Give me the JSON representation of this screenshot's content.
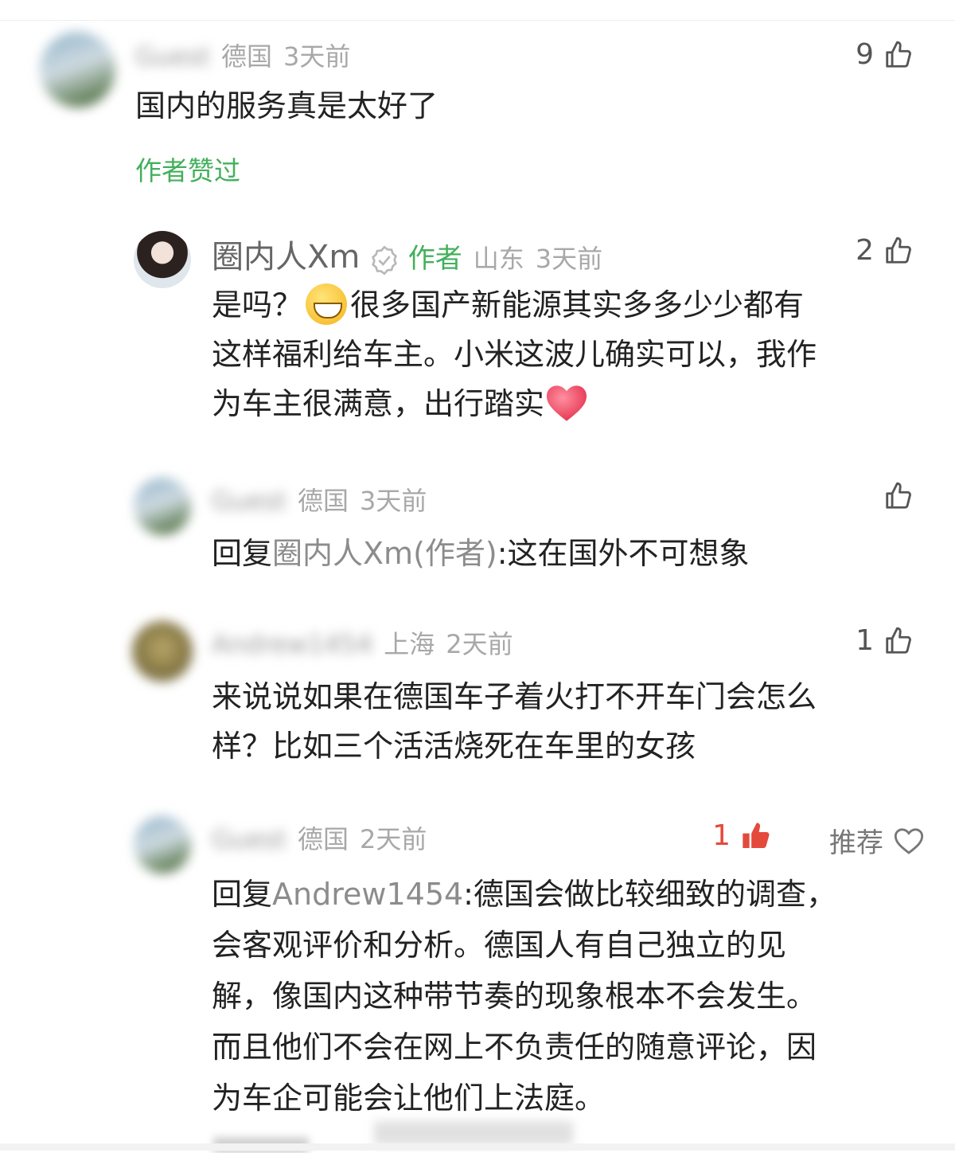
{
  "comments": [
    {
      "username": "Guest",
      "location": "德国",
      "time": "3天前",
      "likes": "9",
      "text": "国内的服务真是太好了",
      "liked_by_author": "作者赞过"
    },
    {
      "username": "圈内人Xm",
      "author_badge": "作者",
      "location": "山东",
      "time": "3天前",
      "likes": "2",
      "text_part1": "是吗？",
      "text_part2": "很多国产新能源其实多多少少都有",
      "text_line2": "这样福利给车主。小米这波儿确实可以，我作",
      "text_line3": "为车主很满意，出行踏实"
    },
    {
      "username": "Guest",
      "location": "德国",
      "time": "3天前",
      "likes": "",
      "reply_prefix": "回复",
      "reply_to": "圈内人Xm(作者)",
      "text": ":这在国外不可想象"
    },
    {
      "username": "Andrew1454",
      "location": "上海",
      "time": "2天前",
      "likes": "1",
      "text_line1": "来说说如果在德国车子着火打不开车门会怎么",
      "text_line2": "样？比如三个活活烧死在车里的女孩"
    },
    {
      "username": "Guest",
      "location": "德国",
      "time": "2天前",
      "likes": "1",
      "recommend": "推荐",
      "reply_prefix": "回复",
      "reply_to": "Andrew1454",
      "text_line1": ":德国会做比较细致的调查，",
      "text_line2": "会客观评价和分析。德国人有自己独立的见",
      "text_line3": "解，像国内这种带节奏的现象根本不会发生。",
      "text_line4": "而且他们不会在网上不负责任的随意评论，因",
      "text_line5": "为车企可能会让他们上法庭。"
    }
  ],
  "colors": {
    "accent_green": "#43b05c",
    "like_active": "#e34a3c",
    "meta_gray": "#a8a8a8"
  },
  "icons": [
    "thumb-up-icon",
    "thumb-up-filled-icon",
    "heart-outline-icon",
    "verified-icon",
    "grin-emoji",
    "heart-emoji"
  ]
}
